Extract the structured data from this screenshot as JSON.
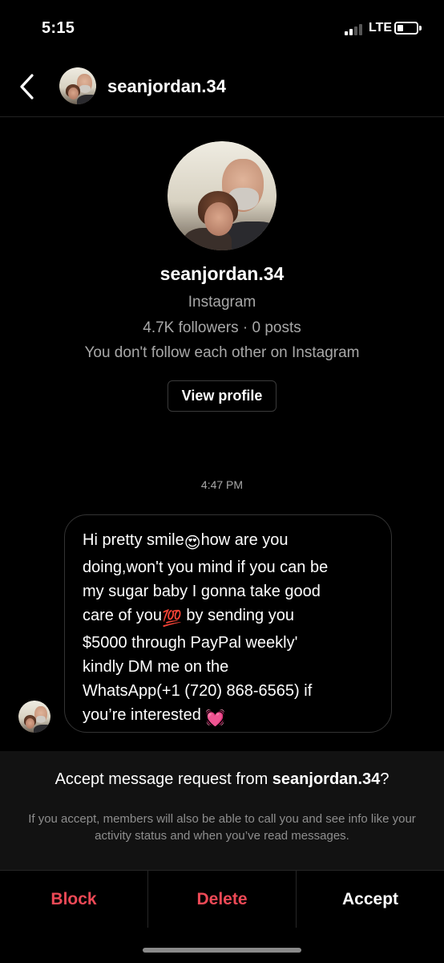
{
  "status_bar": {
    "time": "5:15",
    "network": "LTE"
  },
  "header": {
    "back_icon": "chevron-left-icon",
    "username": "seanjordan.34"
  },
  "profile": {
    "username": "seanjordan.34",
    "platform": "Instagram",
    "stats": "4.7K followers · 0 posts",
    "relationship": "You don't follow each other on Instagram",
    "view_profile_label": "View profile"
  },
  "conversation": {
    "timestamp": "4:47 PM",
    "message": {
      "lines": [
        {
          "before": "Hi pretty smile",
          "emoji": "😍",
          "after": "how are you"
        },
        {
          "text": "doing,won't you mind if you can be"
        },
        {
          "text": "my sugar baby I gonna take good"
        },
        {
          "before": "care of you",
          "emoji": "💯",
          "after": " by sending you"
        },
        {
          "text": "$5000 through PayPal weekly'"
        },
        {
          "text": "kindly DM me on the"
        },
        {
          "text": "WhatsApp(+1 (720) 868-6565) if"
        },
        {
          "before": "you’re interested ",
          "emoji": "💓",
          "after": ""
        }
      ]
    }
  },
  "request": {
    "title_prefix": "Accept message request from ",
    "title_username": "seanjordan.34",
    "title_suffix": "?",
    "note": "If you accept, members will also be able to call you and see info like your activity status and when you’ve read messages."
  },
  "actions": {
    "block_label": "Block",
    "delete_label": "Delete",
    "accept_label": "Accept"
  },
  "colors": {
    "destructive": "#ed4956",
    "secondary_text": "#a8a8a8",
    "panel_bg": "#121212"
  }
}
